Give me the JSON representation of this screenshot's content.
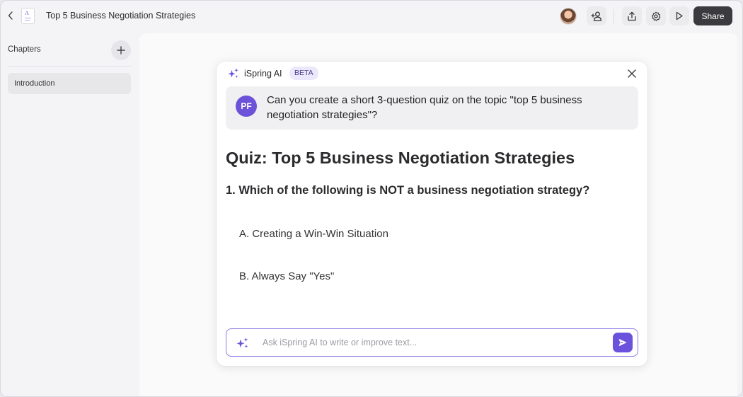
{
  "topbar": {
    "title": "Top 5 Business Negotiation Strategies",
    "share_label": "Share",
    "doc_icon_letter": "A"
  },
  "sidebar": {
    "chapters_label": "Chapters",
    "items": [
      {
        "label": "Introduction",
        "selected": true
      }
    ]
  },
  "ai_panel": {
    "title": "iSpring AI",
    "badge": "BETA",
    "user_initials": "PF",
    "prompt": "Can you create a short 3-question quiz on the topic \"top 5 business negotiation strategies\"?",
    "quiz_title": "Quiz: Top 5 Business Negotiation Strategies",
    "question": "1. Which of the following is NOT a business negotiation strategy?",
    "options": [
      "A. Creating a Win-Win Situation",
      "B. Always Say \"Yes\""
    ],
    "input_placeholder": "Ask iSpring AI to write or improve text..."
  },
  "colors": {
    "accent": "#6a52dc",
    "share_button": "#3b3b3f",
    "badge_bg": "#ece8fb"
  },
  "icons": [
    "chevron-left-icon",
    "document-icon",
    "add-user-icon",
    "export-icon",
    "gear-icon",
    "play-icon",
    "plus-icon",
    "sparkle-icon",
    "close-icon",
    "send-icon"
  ]
}
